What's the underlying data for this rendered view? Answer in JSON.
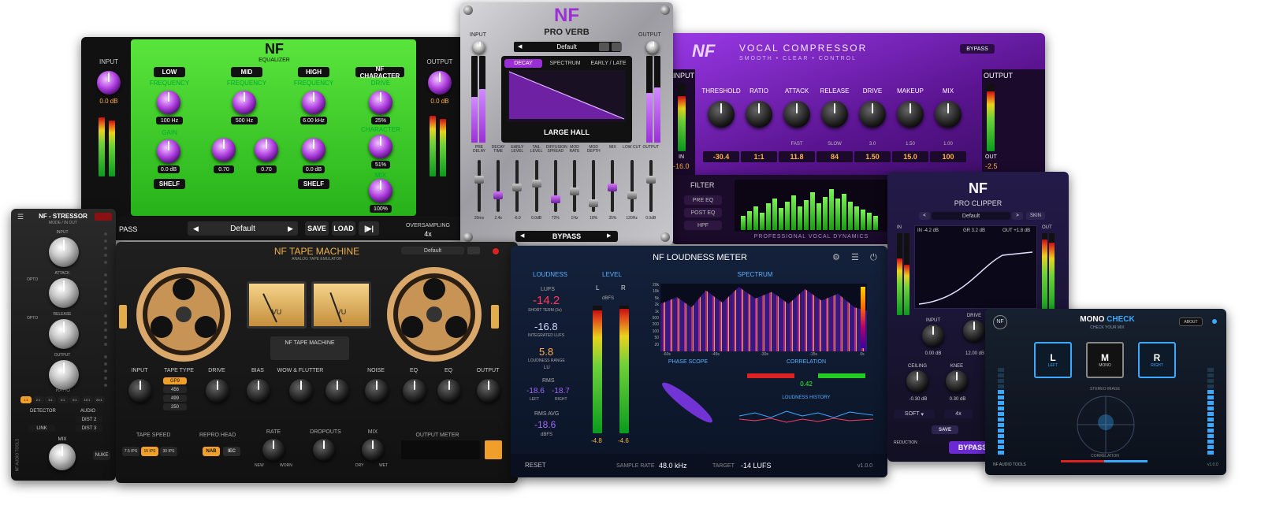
{
  "eq": {
    "title": "EQUALIZER",
    "logo": "NF",
    "input": "INPUT",
    "output": "OUTPUT",
    "input_db": "0.0 dB",
    "output_db": "0.0 dB",
    "bands": {
      "low": "LOW",
      "mid": "MID",
      "high": "HIGH",
      "character": "NF CHARACTER"
    },
    "freq": "FREQUENCY",
    "gain": "GAIN",
    "q": "Q",
    "drive": "DRIVE",
    "character_lbl": "CHARACTER",
    "mix": "MIX",
    "low_freq": "100 Hz",
    "mid_freq": "500 Hz",
    "high_freq": "6.00 kHz",
    "gain_low": "0.0 dB",
    "gain_mid1": "0.70",
    "gain_mid2": "0.70",
    "gain_high": "0.0 dB",
    "drive_val": "25%",
    "character_val": "51%",
    "mix_val": "100%",
    "shelf": "SHELF",
    "bypass": "PASS",
    "preset": "Default",
    "save": "SAVE",
    "load": "LOAD",
    "oversampling": "OVERSAMPLING",
    "os_val": "4x"
  },
  "verb": {
    "logo": "NF",
    "title": "PRO VERB",
    "input": "INPUT",
    "output": "OUTPUT",
    "preset": "Default",
    "tabs": [
      "DECAY",
      "SPECTRUM",
      "EARLY / LATE"
    ],
    "room": "LARGE HALL",
    "bypass": "BYPASS",
    "faders": [
      "PRE DELAY",
      "DECAY TIME",
      "EARLY LEVEL",
      "TAIL LEVEL",
      "DIFFUSION SPREAD",
      "MOD RATE",
      "MOD DEPTH",
      "MIX",
      "LOW CUT",
      "OUTPUT"
    ],
    "fader_vals": [
      "20ms",
      "2.4s",
      "-6.0",
      "0.0dB",
      "72%",
      "1Hz",
      "18%",
      "35%",
      "120Hz",
      "0.0dB"
    ]
  },
  "vc": {
    "logo": "NF",
    "title": "VOCAL COMPRESSOR",
    "subtitle": "SMOOTH • CLEAR • CONTROL",
    "bypass": "BYPASS",
    "input": "INPUT",
    "output": "OUTPUT",
    "knobs": [
      "THRESHOLD",
      "RATIO",
      "ATTACK",
      "RELEASE",
      "DRIVE",
      "MAKEUP",
      "MIX"
    ],
    "knob_modes": [
      "",
      "",
      "FAST",
      "SLOW",
      "3.0",
      "1.50",
      "1.00"
    ],
    "values": [
      "-30.4",
      "1:1",
      "11.8",
      "84",
      "1.50",
      "15.0",
      "100"
    ],
    "in": "IN",
    "in_val": "-16.0",
    "out": "OUT",
    "out_val": "-2.5",
    "filter": "FILTER",
    "filter_items": [
      "PRE EQ",
      "POST EQ",
      "HPF"
    ],
    "footer": "PROFESSIONAL VOCAL DYNAMICS"
  },
  "stressor": {
    "title": "NF - STRESSOR",
    "sub": "MODE / IN OUT",
    "knobs": [
      "INPUT",
      "ATTACK",
      "RELEASE",
      "OUTPUT"
    ],
    "opto": "OPTO",
    "ratio": "RATIO",
    "ratios": [
      "1:1",
      "2:1",
      "3:1",
      "4:1",
      "6:1",
      "10:1",
      "20:1"
    ],
    "detector": "DETECTOR",
    "audio": "AUDIO",
    "link": "LINK",
    "dist2": "DIST 2",
    "dist3": "DIST 3",
    "mix": "MIX",
    "nuke": "NUKE",
    "brand": "NF AUDIO TOOLS"
  },
  "tape": {
    "logo": "NF",
    "title": "TAPE MACHINE",
    "sub": "ANALOG TAPE EMULATOR",
    "preset": "Default",
    "vu1": "VU",
    "vu2": "VU",
    "plate": "NF TAPE MACHINE",
    "knobs": [
      "INPUT",
      "TAPE TYPE",
      "DRIVE",
      "BIAS",
      "WOW & FLUTTER",
      "",
      "NOISE",
      "EQ",
      "EQ",
      "OUTPUT"
    ],
    "tape_types": [
      "GP9",
      "456",
      "499",
      "250"
    ],
    "tape_speed": "TAPE SPEED",
    "speeds": [
      "7.5 IPS",
      "15 IPS",
      "30 IPS"
    ],
    "repro": "REPRO HEAD",
    "heads": [
      "NAB",
      "IEC"
    ],
    "rate": "RATE",
    "dropouts": "DROPOUTS",
    "mix": "MIX",
    "output_meter": "OUTPUT METER",
    "new": "NEW",
    "worn": "WORN",
    "dry": "DRY",
    "wet": "WET"
  },
  "loud": {
    "logo": "NF",
    "title": "LOUDNESS METER",
    "loudness": "LOUDNESS",
    "level": "LEVEL",
    "spectrum": "SPECTRUM",
    "lufs_lbl": "LUFS",
    "lufs": "-14.2",
    "short_term": "SHORT TERM (3s)",
    "integrated": "-16.8",
    "integrated_lbl": "INTEGRATED LUFS",
    "range": "5.8",
    "range_lbl": "LOUDNESS RANGE",
    "lu": "LU",
    "rms": "RMS",
    "rms_l": "-18.6",
    "rms_r": "-18.7",
    "left": "LEFT",
    "right": "RIGHT",
    "rms_avg_lbl": "RMS AVG",
    "rms_avg": "-18.6",
    "dbfs": "dBFS",
    "L": "L",
    "R": "R",
    "l_val": "-4.8",
    "r_val": "-4.6",
    "phase": "PHASE SCOPE",
    "correlation": "CORRELATION",
    "corr_val": "0.42",
    "history": "LOUDNESS HISTORY",
    "reset": "RESET",
    "sample_rate_lbl": "SAMPLE RATE",
    "sample_rate": "48.0 kHz",
    "target_lbl": "TARGET",
    "target": "-14 LUFS",
    "version": "v1.0.0",
    "freqs": [
      "20k",
      "10k",
      "5k",
      "2k",
      "1k",
      "500",
      "200",
      "100",
      "50",
      "20"
    ],
    "times": [
      "-60s",
      "-45s",
      "-30s",
      "-15s",
      "0s"
    ]
  },
  "clip": {
    "logo": "NF",
    "title": "PRO CLIPPER",
    "preset": "Default",
    "skin": "SKIN",
    "in": "IN",
    "out": "OUT",
    "in_val": "IN -4.2 dB",
    "gr_val": "GR 3.2 dB",
    "out_val": "OUT +1.8 dB",
    "input": "INPUT",
    "drive": "DRIVE",
    "ceiling": "CEILING",
    "knee": "KNEE",
    "input_val": "0.00 dB",
    "drive_val": "12.00 dB",
    "ceiling_val": "-0.30 dB",
    "knee_val": "0.30 dB",
    "soft": "SOFT",
    "os": "4x",
    "save": "SAVE",
    "bypass": "BYPASS",
    "reduction": "REDUCTION"
  },
  "mono": {
    "logo": "NF",
    "title1": "MONO",
    "title2": "CHECK",
    "sub": "CHECK YOUR MIX",
    "about": "ABOUT",
    "L": "L",
    "M": "M",
    "R": "R",
    "left": "LEFT",
    "mono": "MONO",
    "right": "RIGHT",
    "stereo": "STEREO IMAGE",
    "correlation": "CORRELATION",
    "brand": "NF AUDIO TOOLS",
    "version": "v1.0.0"
  },
  "colors": {
    "eq": "#3cdc2a",
    "purple": "#8a2be2",
    "accent": "#ff3b5c",
    "orange": "#ffb347",
    "blue": "#3aa9ff"
  }
}
